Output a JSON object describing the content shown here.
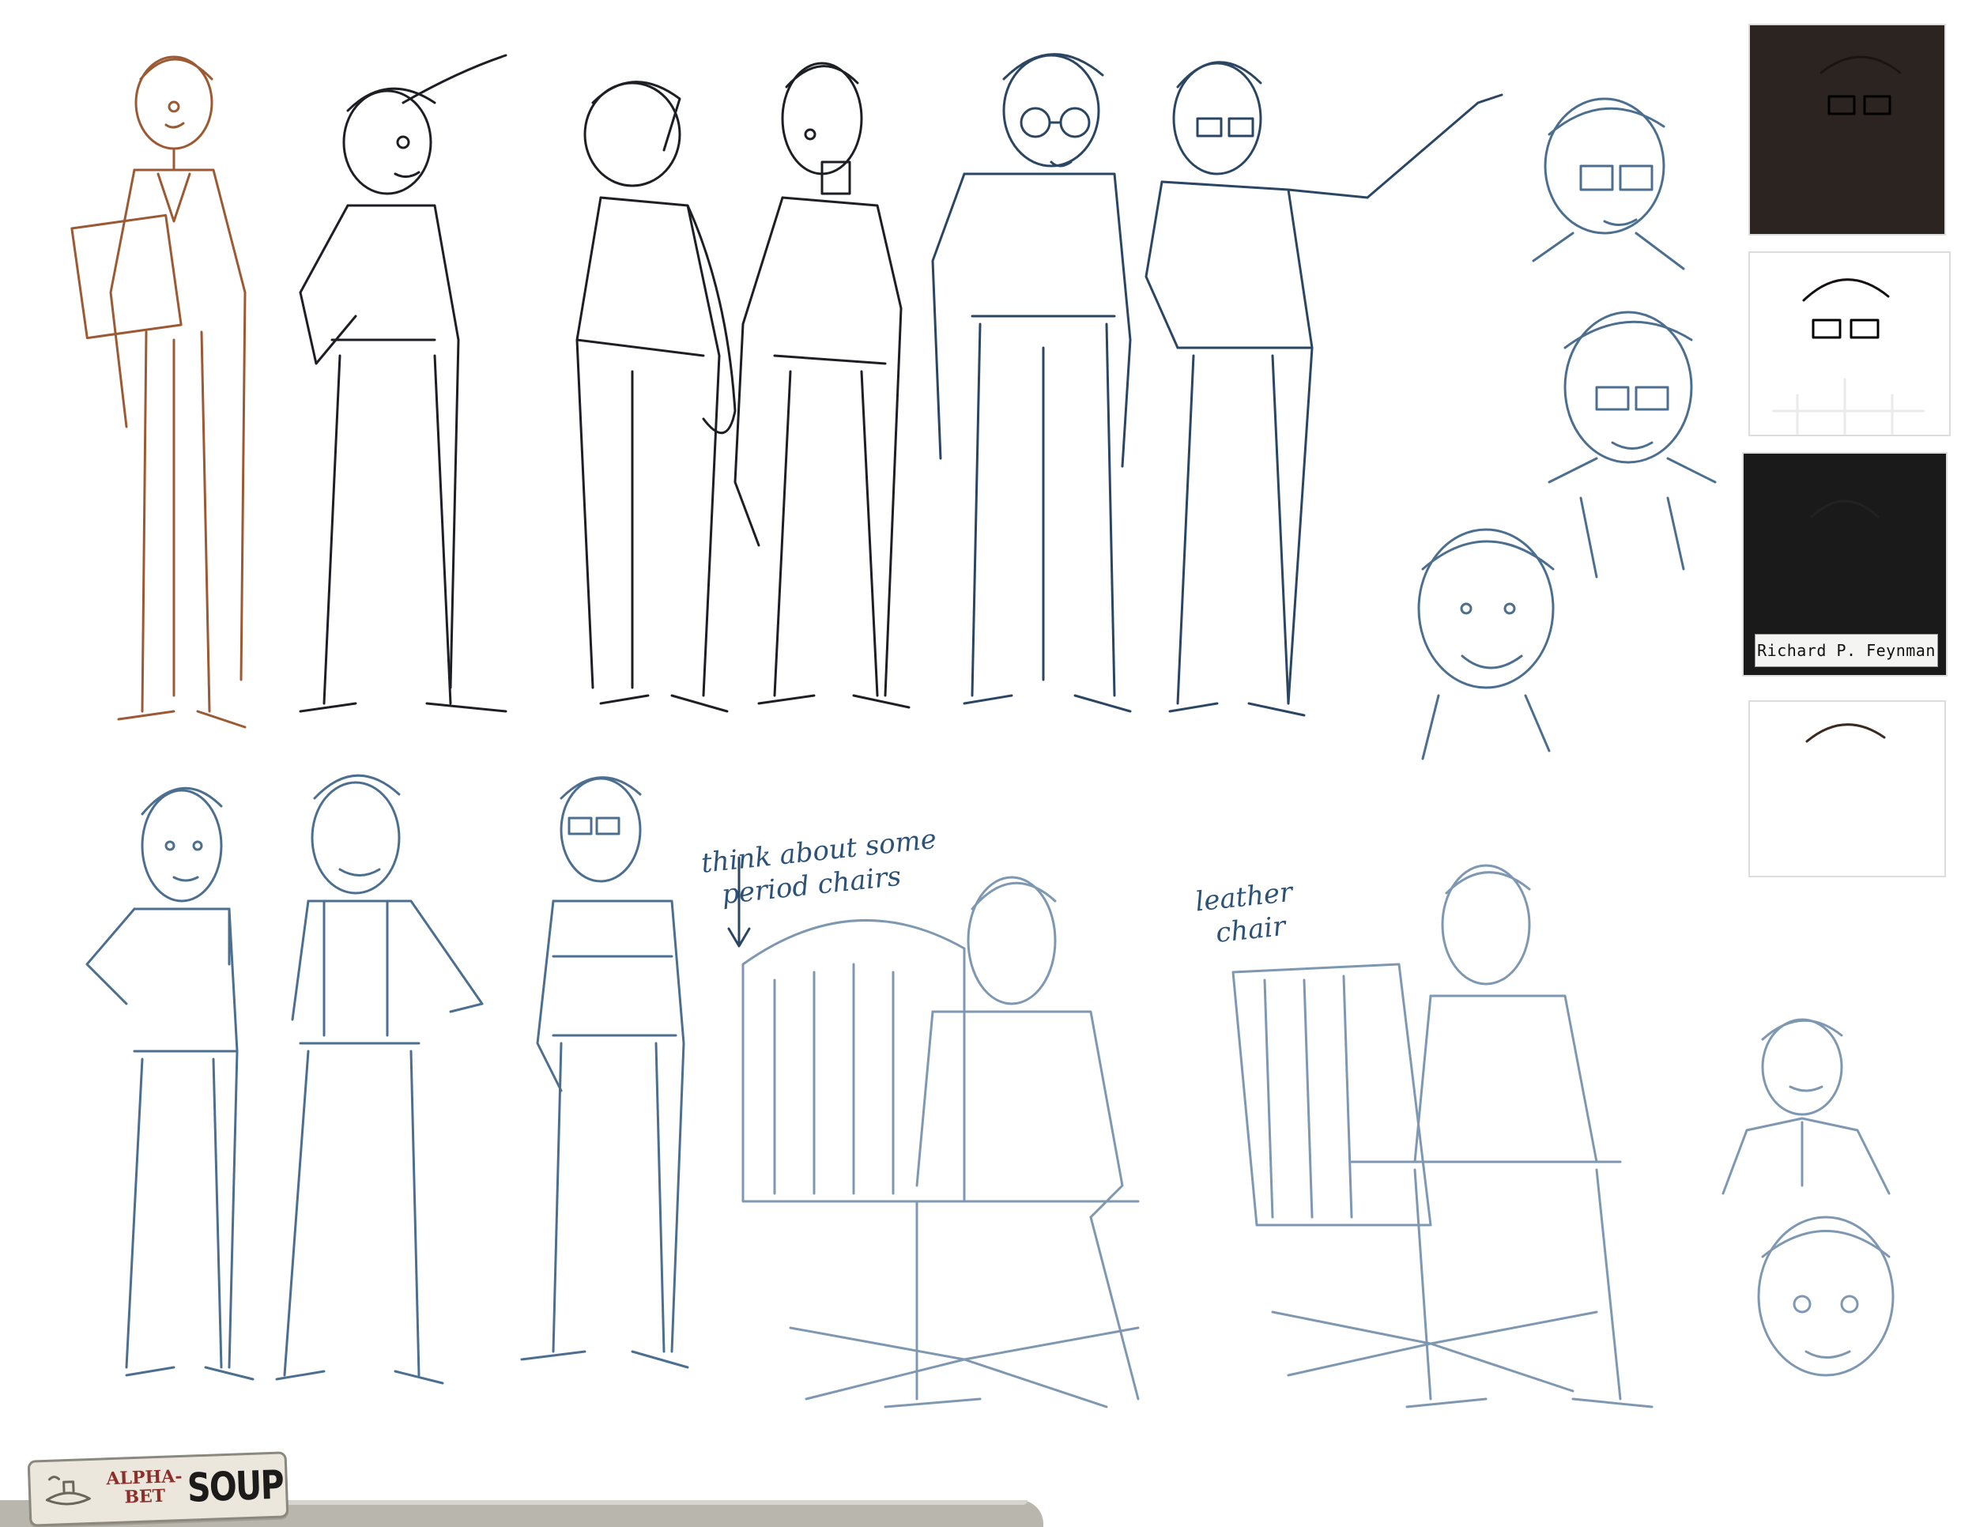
{
  "notes": {
    "chairs": "think about some\n  period chairs",
    "leather": "leather\n  chair"
  },
  "references": {
    "feynman_caption": "Richard P. Feynman"
  },
  "logo": {
    "line1": "ALPHA-\nBET",
    "line2": "SOUP"
  },
  "colors": {
    "brown_pencil": "#9b5a33",
    "black_pencil": "#1d1f24",
    "navy_pencil": "#2b4663",
    "blue_pencil": "#4d6f8f",
    "logo_red": "#8b2f2b"
  }
}
